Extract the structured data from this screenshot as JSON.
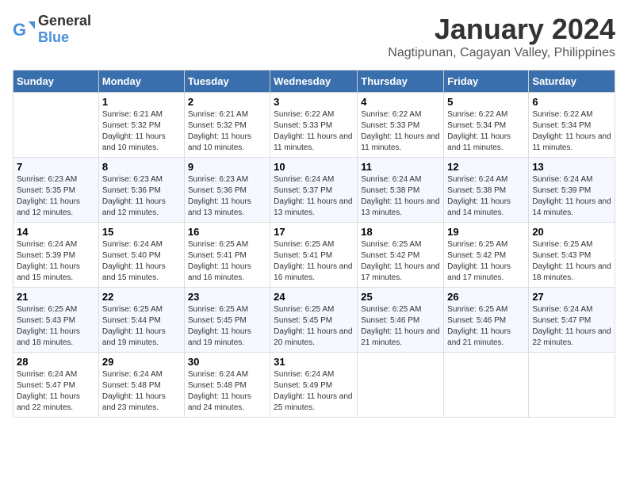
{
  "header": {
    "logo_general": "General",
    "logo_blue": "Blue",
    "month_title": "January 2024",
    "location": "Nagtipunan, Cagayan Valley, Philippines"
  },
  "weekdays": [
    "Sunday",
    "Monday",
    "Tuesday",
    "Wednesday",
    "Thursday",
    "Friday",
    "Saturday"
  ],
  "weeks": [
    [
      {
        "day": "",
        "empty": true
      },
      {
        "day": "1",
        "sunrise": "6:21 AM",
        "sunset": "5:32 PM",
        "daylight": "11 hours and 10 minutes."
      },
      {
        "day": "2",
        "sunrise": "6:21 AM",
        "sunset": "5:32 PM",
        "daylight": "11 hours and 10 minutes."
      },
      {
        "day": "3",
        "sunrise": "6:22 AM",
        "sunset": "5:33 PM",
        "daylight": "11 hours and 11 minutes."
      },
      {
        "day": "4",
        "sunrise": "6:22 AM",
        "sunset": "5:33 PM",
        "daylight": "11 hours and 11 minutes."
      },
      {
        "day": "5",
        "sunrise": "6:22 AM",
        "sunset": "5:34 PM",
        "daylight": "11 hours and 11 minutes."
      },
      {
        "day": "6",
        "sunrise": "6:22 AM",
        "sunset": "5:34 PM",
        "daylight": "11 hours and 11 minutes."
      }
    ],
    [
      {
        "day": "7",
        "sunrise": "6:23 AM",
        "sunset": "5:35 PM",
        "daylight": "11 hours and 12 minutes."
      },
      {
        "day": "8",
        "sunrise": "6:23 AM",
        "sunset": "5:36 PM",
        "daylight": "11 hours and 12 minutes."
      },
      {
        "day": "9",
        "sunrise": "6:23 AM",
        "sunset": "5:36 PM",
        "daylight": "11 hours and 13 minutes."
      },
      {
        "day": "10",
        "sunrise": "6:24 AM",
        "sunset": "5:37 PM",
        "daylight": "11 hours and 13 minutes."
      },
      {
        "day": "11",
        "sunrise": "6:24 AM",
        "sunset": "5:38 PM",
        "daylight": "11 hours and 13 minutes."
      },
      {
        "day": "12",
        "sunrise": "6:24 AM",
        "sunset": "5:38 PM",
        "daylight": "11 hours and 14 minutes."
      },
      {
        "day": "13",
        "sunrise": "6:24 AM",
        "sunset": "5:39 PM",
        "daylight": "11 hours and 14 minutes."
      }
    ],
    [
      {
        "day": "14",
        "sunrise": "6:24 AM",
        "sunset": "5:39 PM",
        "daylight": "11 hours and 15 minutes."
      },
      {
        "day": "15",
        "sunrise": "6:24 AM",
        "sunset": "5:40 PM",
        "daylight": "11 hours and 15 minutes."
      },
      {
        "day": "16",
        "sunrise": "6:25 AM",
        "sunset": "5:41 PM",
        "daylight": "11 hours and 16 minutes."
      },
      {
        "day": "17",
        "sunrise": "6:25 AM",
        "sunset": "5:41 PM",
        "daylight": "11 hours and 16 minutes."
      },
      {
        "day": "18",
        "sunrise": "6:25 AM",
        "sunset": "5:42 PM",
        "daylight": "11 hours and 17 minutes."
      },
      {
        "day": "19",
        "sunrise": "6:25 AM",
        "sunset": "5:42 PM",
        "daylight": "11 hours and 17 minutes."
      },
      {
        "day": "20",
        "sunrise": "6:25 AM",
        "sunset": "5:43 PM",
        "daylight": "11 hours and 18 minutes."
      }
    ],
    [
      {
        "day": "21",
        "sunrise": "6:25 AM",
        "sunset": "5:43 PM",
        "daylight": "11 hours and 18 minutes."
      },
      {
        "day": "22",
        "sunrise": "6:25 AM",
        "sunset": "5:44 PM",
        "daylight": "11 hours and 19 minutes."
      },
      {
        "day": "23",
        "sunrise": "6:25 AM",
        "sunset": "5:45 PM",
        "daylight": "11 hours and 19 minutes."
      },
      {
        "day": "24",
        "sunrise": "6:25 AM",
        "sunset": "5:45 PM",
        "daylight": "11 hours and 20 minutes."
      },
      {
        "day": "25",
        "sunrise": "6:25 AM",
        "sunset": "5:46 PM",
        "daylight": "11 hours and 21 minutes."
      },
      {
        "day": "26",
        "sunrise": "6:25 AM",
        "sunset": "5:46 PM",
        "daylight": "11 hours and 21 minutes."
      },
      {
        "day": "27",
        "sunrise": "6:24 AM",
        "sunset": "5:47 PM",
        "daylight": "11 hours and 22 minutes."
      }
    ],
    [
      {
        "day": "28",
        "sunrise": "6:24 AM",
        "sunset": "5:47 PM",
        "daylight": "11 hours and 22 minutes."
      },
      {
        "day": "29",
        "sunrise": "6:24 AM",
        "sunset": "5:48 PM",
        "daylight": "11 hours and 23 minutes."
      },
      {
        "day": "30",
        "sunrise": "6:24 AM",
        "sunset": "5:48 PM",
        "daylight": "11 hours and 24 minutes."
      },
      {
        "day": "31",
        "sunrise": "6:24 AM",
        "sunset": "5:49 PM",
        "daylight": "11 hours and 25 minutes."
      },
      {
        "day": "",
        "empty": true
      },
      {
        "day": "",
        "empty": true
      },
      {
        "day": "",
        "empty": true
      }
    ]
  ]
}
